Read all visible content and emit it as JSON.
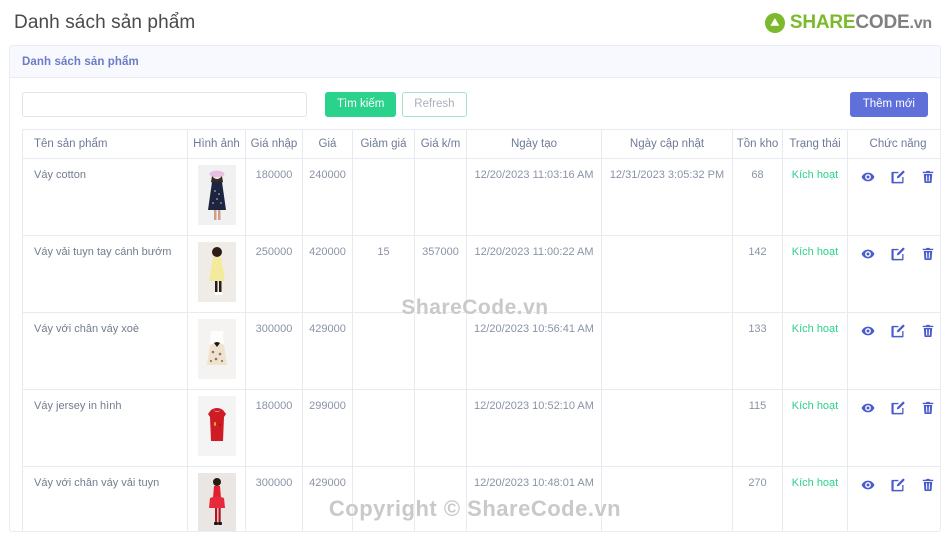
{
  "header": {
    "page_title": "Danh sách sản phẩm",
    "logo": {
      "share": "SHARE",
      "code": "CODE",
      "vn": ".vn"
    }
  },
  "card": {
    "title": "Danh sách sản phẩm"
  },
  "toolbar": {
    "search_value": "",
    "search_placeholder": "",
    "search_label": "Tìm kiếm",
    "refresh_label": "Refresh",
    "add_label": "Thêm mới"
  },
  "table": {
    "columns": [
      "Tên sản phẩm",
      "Hình ảnh",
      "Giá nhập",
      "Giá",
      "Giảm giá",
      "Giá k/m",
      "Ngày tạo",
      "Ngày cập nhật",
      "Tồn kho",
      "Trạng thái",
      "Chức năng"
    ],
    "rows": [
      {
        "name": "Váy cotton",
        "image": "navy-polka-dress",
        "gia_nhap": "180000",
        "gia": "240000",
        "giam_gia": "",
        "gia_km": "",
        "ngay_tao": "12/20/2023 11:03:16 AM",
        "ngay_cap_nhat": "12/31/2023 3:05:32 PM",
        "ton_kho": "68",
        "trang_thai": "Kích hoạt"
      },
      {
        "name": "Váy vải tuyn tay cánh bướm",
        "image": "yellow-tulle-dress",
        "gia_nhap": "250000",
        "gia": "420000",
        "giam_gia": "15",
        "gia_km": "357000",
        "ngay_tao": "12/20/2023 11:00:22 AM",
        "ngay_cap_nhat": "",
        "ton_kho": "142",
        "trang_thai": "Kích hoạt"
      },
      {
        "name": "Váy với chân váy xoè",
        "image": "white-floral-dress",
        "gia_nhap": "300000",
        "gia": "429000",
        "giam_gia": "",
        "gia_km": "",
        "ngay_tao": "12/20/2023 10:56:41 AM",
        "ngay_cap_nhat": "",
        "ton_kho": "133",
        "trang_thai": "Kích hoạt"
      },
      {
        "name": "Váy jersey in hình",
        "image": "red-jersey-dress",
        "gia_nhap": "180000",
        "gia": "299000",
        "giam_gia": "",
        "gia_km": "",
        "ngay_tao": "12/20/2023 10:52:10 AM",
        "ngay_cap_nhat": "",
        "ton_kho": "115",
        "trang_thai": "Kích hoạt"
      },
      {
        "name": "Váy với chân váy vải tuyn",
        "image": "red-tulle-dress",
        "gia_nhap": "300000",
        "gia": "429000",
        "giam_gia": "",
        "gia_km": "",
        "ngay_tao": "12/20/2023 10:48:01 AM",
        "ngay_cap_nhat": "",
        "ton_kho": "270",
        "trang_thai": "Kích hoạt"
      }
    ],
    "action_icons": [
      "eye-icon",
      "edit-icon",
      "delete-icon"
    ]
  },
  "watermarks": {
    "middle": "ShareCode.vn",
    "bottom": "Copyright © ShareCode.vn"
  },
  "colors": {
    "accent_green": "#2bd28b",
    "accent_blue": "#5f70da",
    "logo_green": "#7cb92c",
    "header_text": "#6b7bc4"
  }
}
